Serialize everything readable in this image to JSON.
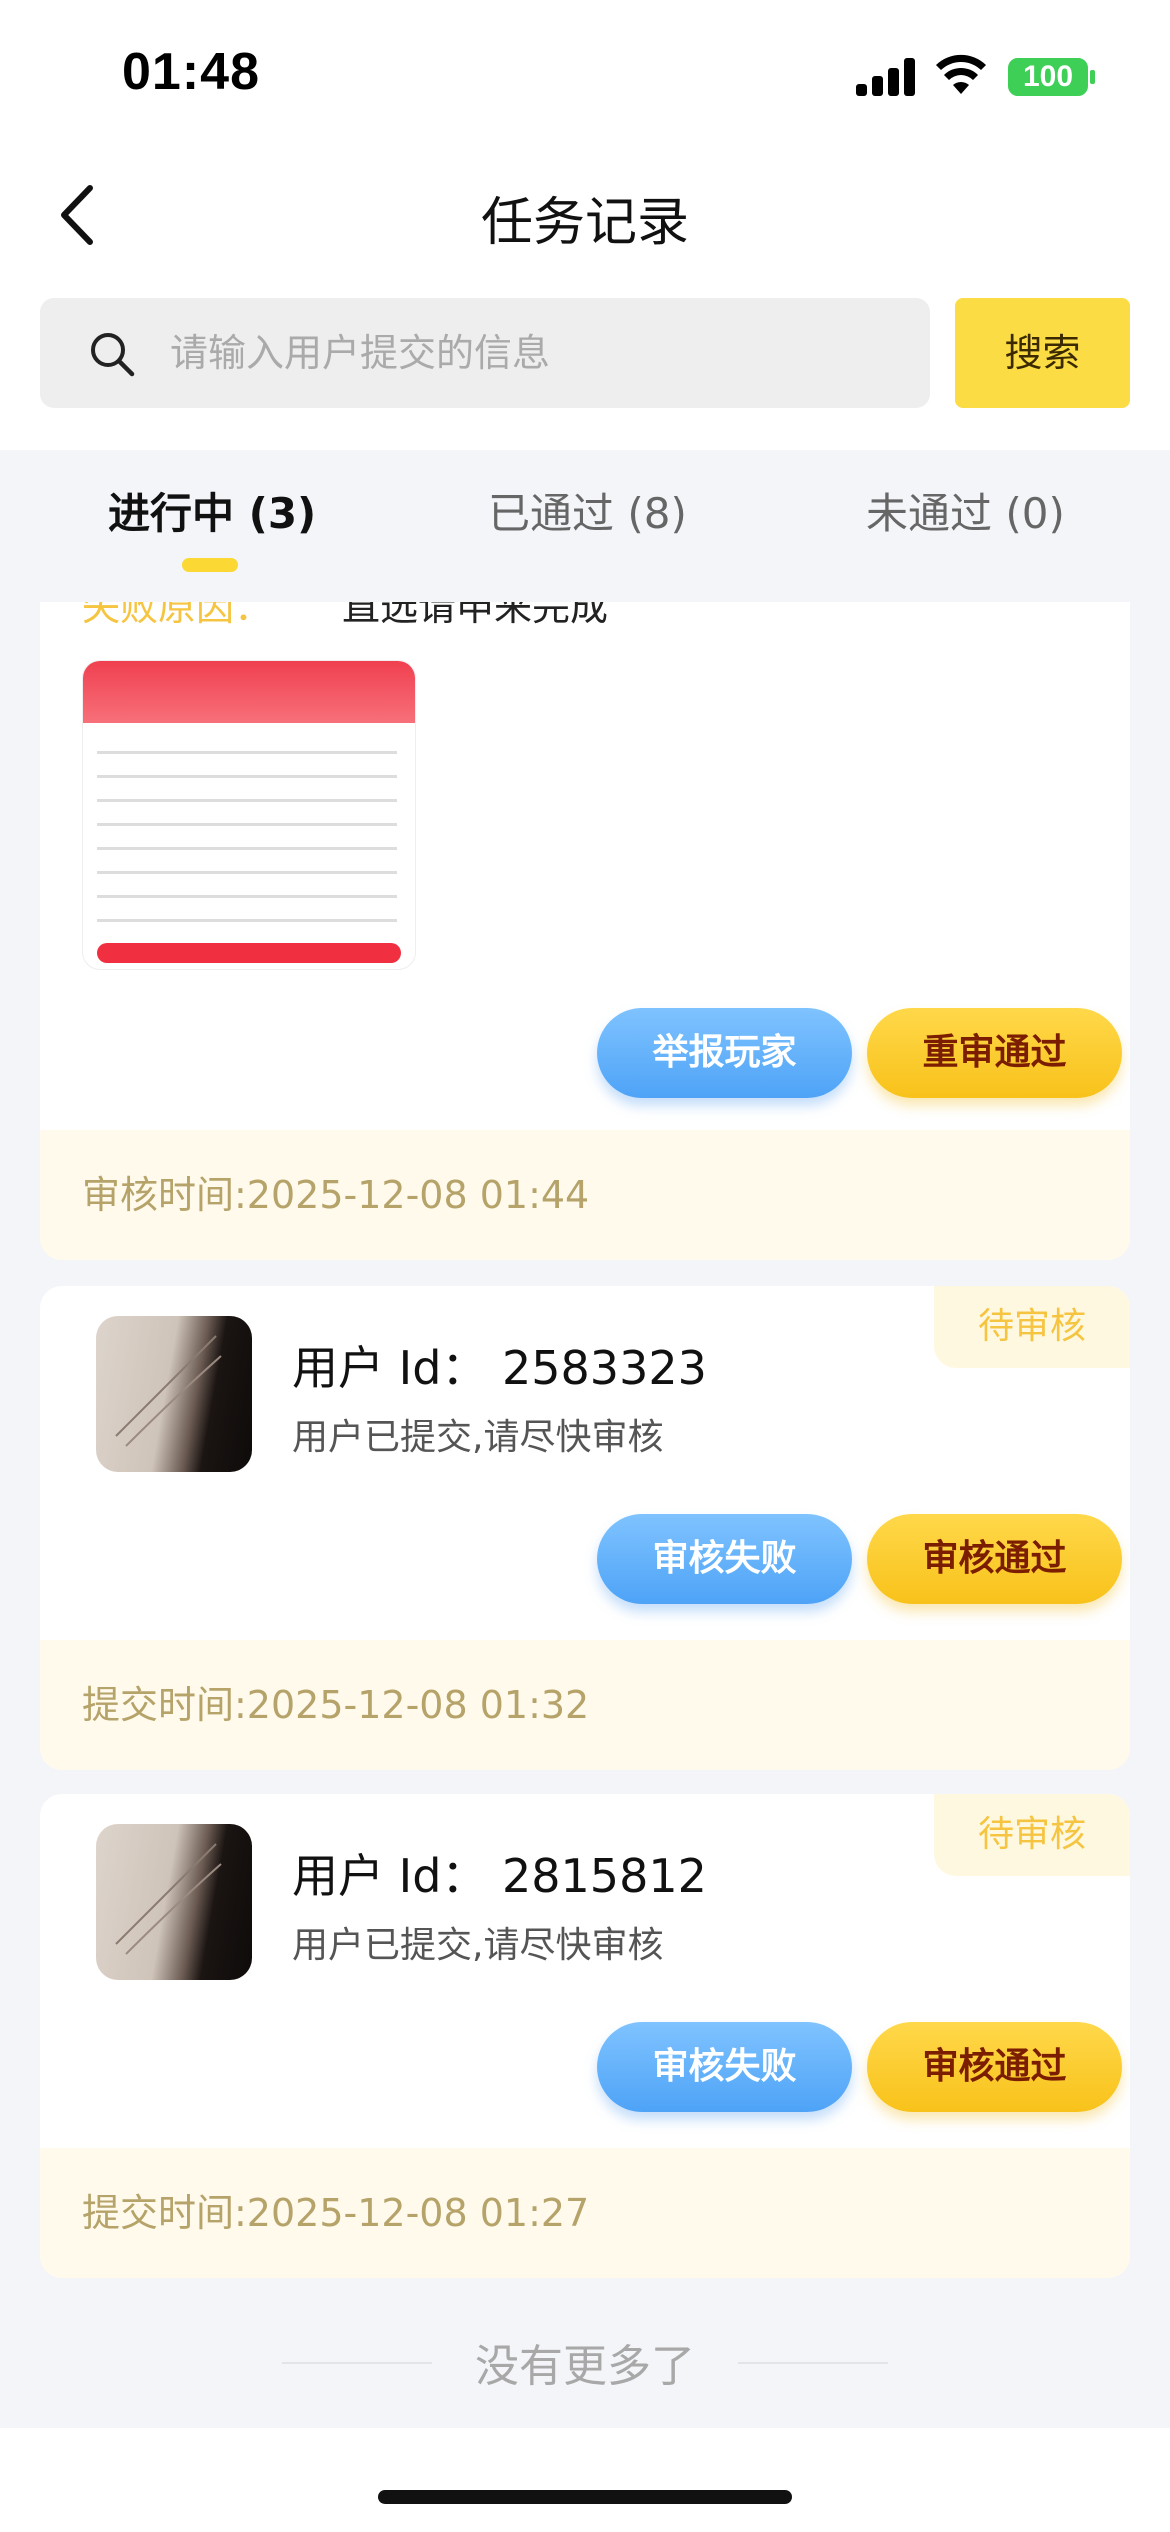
{
  "status_bar": {
    "time": "01:48",
    "battery": "100"
  },
  "nav": {
    "title": "任务记录"
  },
  "search": {
    "placeholder": "请输入用户提交的信息",
    "button_label": "搜索"
  },
  "tabs": [
    {
      "label": "进行中 (3)",
      "active": true
    },
    {
      "label": "已通过 (8)",
      "active": false
    },
    {
      "label": "未通过 (0)",
      "active": false
    }
  ],
  "cards": [
    {
      "fail_reason_label": "失败原因：",
      "fail_reason_value": "直选请申来完成",
      "actions": [
        "举报玩家",
        "重审通过"
      ],
      "footer": "审核时间:2025-12-08 01:44"
    },
    {
      "user_id": "用户 Id：  2583323",
      "status_text": "用户已提交,请尽快审核",
      "badge": "待审核",
      "actions": [
        "审核失败",
        "审核通过"
      ],
      "footer": "提交时间:2025-12-08 01:32"
    },
    {
      "user_id": "用户 Id：  2815812",
      "status_text": "用户已提交,请尽快审核",
      "badge": "待审核",
      "actions": [
        "审核失败",
        "审核通过"
      ],
      "footer": "提交时间:2025-12-08 01:27"
    }
  ],
  "list_end_text": "没有更多了",
  "colors": {
    "accent_yellow": "#fbdc44",
    "button_blue": "#4ea3f7",
    "footer_bg": "#fffaeb"
  }
}
